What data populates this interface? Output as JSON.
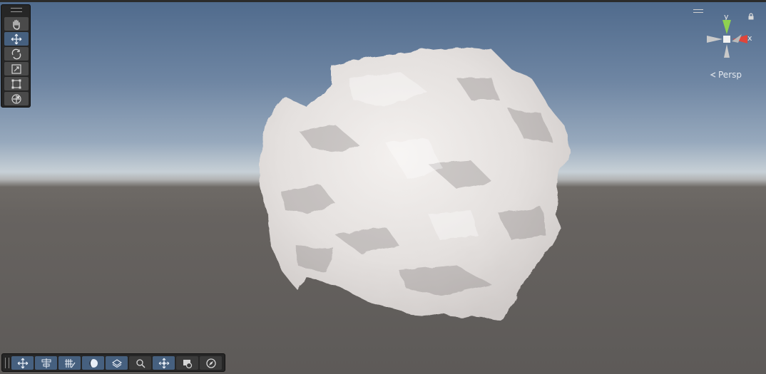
{
  "scene": {
    "view_mode_label": "Persp",
    "axis_labels": {
      "y": "y",
      "x": "x"
    },
    "colors": {
      "sky_top": "#4f6a8c",
      "horizon": "#c7d0d6",
      "ground": "#676360",
      "active_tool": "#46607f",
      "y_axis": "#8fd14f",
      "x_axis": "#e0453a",
      "mesh": "#eeeae8"
    }
  },
  "tool_palette": {
    "tools": [
      {
        "name": "hand-tool",
        "icon": "hand-icon",
        "active": false
      },
      {
        "name": "move-tool",
        "icon": "move-arrows-icon",
        "active": true
      },
      {
        "name": "rotate-tool",
        "icon": "rotate-icon",
        "active": false
      },
      {
        "name": "scale-tool",
        "icon": "scale-icon",
        "active": false
      },
      {
        "name": "rect-tool",
        "icon": "rect-transform-icon",
        "active": false
      },
      {
        "name": "transform-tool",
        "icon": "transform-icon",
        "active": false
      }
    ]
  },
  "overlay_toolbar": {
    "buttons": [
      {
        "name": "move-overlay",
        "icon": "move-arrows-icon",
        "active": true
      },
      {
        "name": "align-overlay",
        "icon": "align-icon",
        "active": true
      },
      {
        "name": "grid-overlay",
        "icon": "grid-brush-icon",
        "active": true
      },
      {
        "name": "shading-overlay",
        "icon": "shading-sphere-icon",
        "active": true
      },
      {
        "name": "layers-overlay",
        "icon": "layers-icon",
        "active": true
      },
      {
        "name": "search-overlay",
        "icon": "search-icon",
        "active": false
      },
      {
        "name": "pivot-overlay",
        "icon": "pivot-icon",
        "active": true
      },
      {
        "name": "camera-overlay",
        "icon": "camera-icon",
        "active": false
      },
      {
        "name": "compass-overlay",
        "icon": "compass-icon",
        "active": false
      }
    ]
  }
}
